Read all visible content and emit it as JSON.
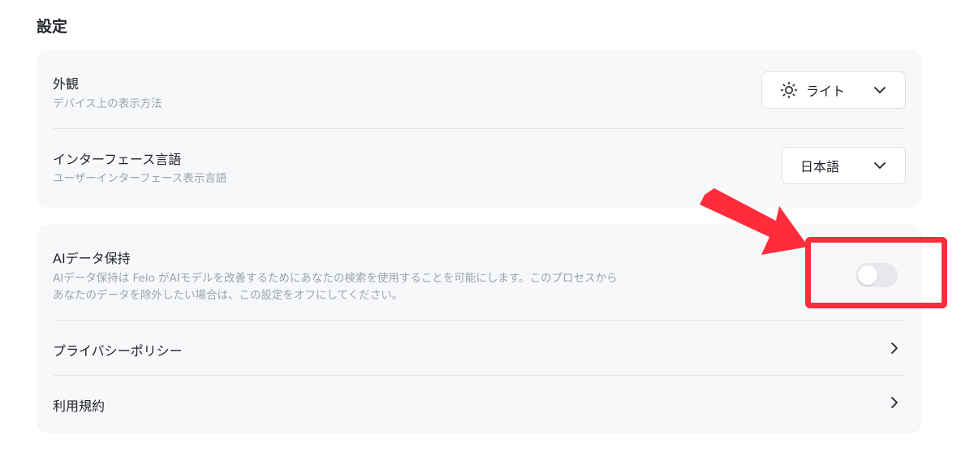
{
  "page": {
    "title": "設定"
  },
  "appearance": {
    "title": "外観",
    "subtitle": "デバイス上の表示方法",
    "value": "ライト",
    "icon": "sun-icon"
  },
  "language": {
    "title": "インターフェース言語",
    "subtitle": "ユーザーインターフェース表示言語",
    "value": "日本語"
  },
  "ai_data": {
    "title": "AIデータ保持",
    "description_line1": "AIデータ保持は Felo がAIモデルを改善するためにあなたの検索を使用することを可能にします。このプロセスから",
    "description_line2": "あなたのデータを除外したい場合は、この設定をオフにしてください。",
    "toggle_on": false
  },
  "links": {
    "privacy": "プライバシーポリシー",
    "terms": "利用規約"
  },
  "colors": {
    "annotation": "#ff2d3b",
    "card_bg": "#f7f8fa",
    "muted_text": "#9aa3af"
  }
}
